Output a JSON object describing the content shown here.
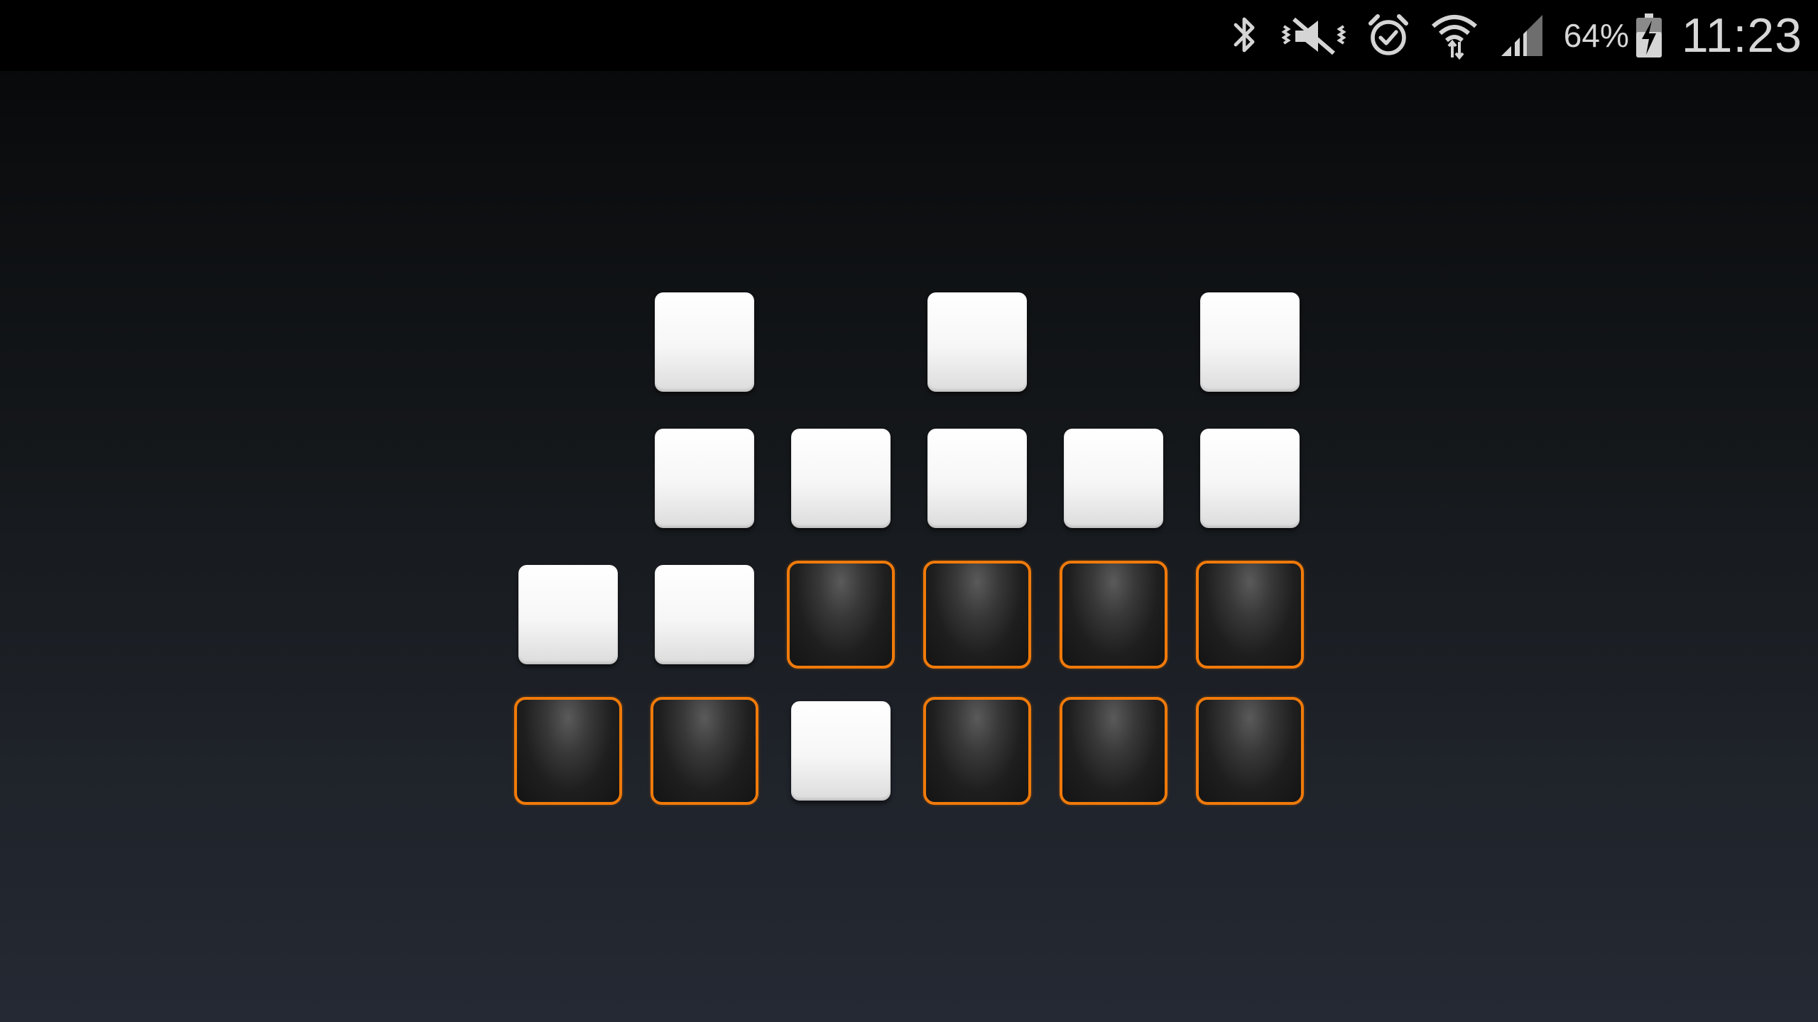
{
  "status_bar": {
    "icons": [
      "bluetooth-icon",
      "vibrate-mute-icon",
      "alarm-icon",
      "wifi-icon",
      "cell-signal-icon",
      "battery-charging-icon"
    ],
    "battery_percent": "64%",
    "time": "11:23"
  },
  "colors": {
    "pad_on": "#f4f4f4",
    "pad_off": "#1c1c1c",
    "pad_off_border": "#f07a0a",
    "background_top": "#050607",
    "background_bottom": "#242933"
  },
  "pad_grid": {
    "columns": 6,
    "rows": [
      [
        "empty",
        "on",
        "empty",
        "on",
        "empty",
        "on"
      ],
      [
        "empty",
        "on",
        "on",
        "on",
        "on",
        "on"
      ],
      [
        "on",
        "on",
        "off",
        "off",
        "off",
        "off"
      ],
      [
        "off",
        "off",
        "on",
        "off",
        "off",
        "off"
      ]
    ]
  }
}
